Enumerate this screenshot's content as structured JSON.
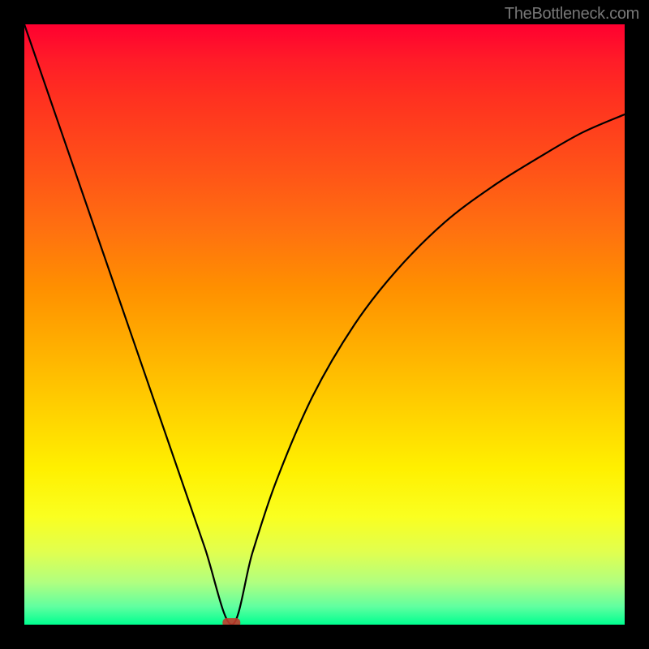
{
  "watermark": "TheBottleneck.com",
  "colors": {
    "black": "#000000",
    "curve": "#000000",
    "marker": "#b93a2f"
  },
  "chart_data": {
    "type": "line",
    "title": "",
    "xlabel": "",
    "ylabel": "",
    "xlim": [
      0,
      100
    ],
    "ylim": [
      0,
      100
    ],
    "grid": false,
    "legend": false,
    "series": [
      {
        "name": "bottleneck-curve",
        "x": [
          0,
          5,
          10,
          15,
          20,
          25,
          30,
          34.5,
          38,
          42,
          48,
          55,
          62,
          70,
          78,
          86,
          93,
          100
        ],
        "values": [
          100,
          85.5,
          71,
          56.5,
          42,
          27.5,
          13,
          0,
          12,
          24,
          38,
          50,
          59,
          67,
          73,
          78,
          82,
          85
        ]
      }
    ],
    "annotations": [
      {
        "name": "optimal-marker",
        "x": 34.5,
        "y": 0,
        "shape": "rounded-rect"
      }
    ],
    "background_gradient": {
      "stops": [
        {
          "pos": 0,
          "color": "#ff0030"
        },
        {
          "pos": 50,
          "color": "#ffb000"
        },
        {
          "pos": 80,
          "color": "#faff20"
        },
        {
          "pos": 100,
          "color": "#00ff90"
        }
      ]
    }
  }
}
